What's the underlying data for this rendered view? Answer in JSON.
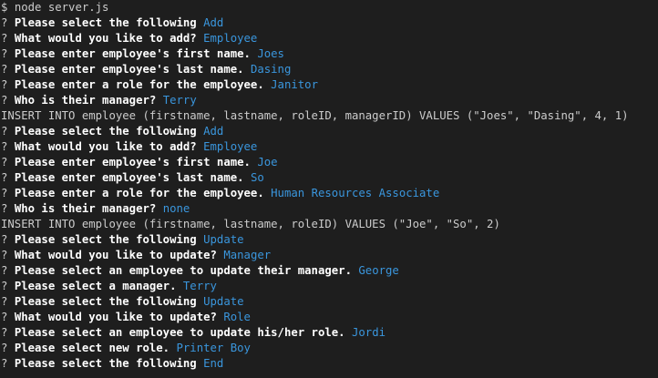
{
  "terminal": {
    "command": {
      "prompt": "$",
      "text": "node server.js"
    },
    "lines": [
      {
        "kind": "question",
        "mark": "?",
        "question": "Please select the following",
        "answer": "Add"
      },
      {
        "kind": "question",
        "mark": "?",
        "question": "What would you like to add?",
        "answer": "Employee"
      },
      {
        "kind": "question",
        "mark": "?",
        "question": "Please enter employee's first name.",
        "answer": "Joes"
      },
      {
        "kind": "question",
        "mark": "?",
        "question": "Please enter employee's last name.",
        "answer": "Dasing"
      },
      {
        "kind": "question",
        "mark": "?",
        "question": "Please enter a role for the employee.",
        "answer": "Janitor"
      },
      {
        "kind": "question",
        "mark": "?",
        "question": "Who is their manager?",
        "answer": "Terry"
      },
      {
        "kind": "output",
        "text": "INSERT INTO employee (firstname, lastname, roleID, managerID) VALUES (\"Joes\", \"Dasing\", 4, 1)"
      },
      {
        "kind": "question",
        "mark": "?",
        "question": "Please select the following",
        "answer": "Add"
      },
      {
        "kind": "question",
        "mark": "?",
        "question": "What would you like to add?",
        "answer": "Employee"
      },
      {
        "kind": "question",
        "mark": "?",
        "question": "Please enter employee's first name.",
        "answer": "Joe"
      },
      {
        "kind": "question",
        "mark": "?",
        "question": "Please enter employee's last name.",
        "answer": "So"
      },
      {
        "kind": "question",
        "mark": "?",
        "question": "Please enter a role for the employee.",
        "answer": "Human Resources Associate"
      },
      {
        "kind": "question",
        "mark": "?",
        "question": "Who is their manager?",
        "answer": "none"
      },
      {
        "kind": "output",
        "text": "INSERT INTO employee (firstname, lastname, roleID) VALUES (\"Joe\", \"So\", 2)"
      },
      {
        "kind": "question",
        "mark": "?",
        "question": "Please select the following",
        "answer": "Update"
      },
      {
        "kind": "question",
        "mark": "?",
        "question": "What would you like to update?",
        "answer": "Manager"
      },
      {
        "kind": "question",
        "mark": "?",
        "question": "Please select an employee to update their manager.",
        "answer": "George"
      },
      {
        "kind": "question",
        "mark": "?",
        "question": "Please select a manager.",
        "answer": "Terry"
      },
      {
        "kind": "question",
        "mark": "?",
        "question": "Please select the following",
        "answer": "Update"
      },
      {
        "kind": "question",
        "mark": "?",
        "question": "What would you like to update?",
        "answer": "Role"
      },
      {
        "kind": "question",
        "mark": "?",
        "question": "Please select an employee to update his/her role.",
        "answer": "Jordi"
      },
      {
        "kind": "question",
        "mark": "?",
        "question": "Please select new role.",
        "answer": "Printer Boy"
      },
      {
        "kind": "question",
        "mark": "?",
        "question": "Please select the following",
        "answer": "End"
      }
    ]
  },
  "colors": {
    "background": "#1e1e1e",
    "text": "#cccccc",
    "question": "#ffffff",
    "answer": "#3a96dd"
  }
}
